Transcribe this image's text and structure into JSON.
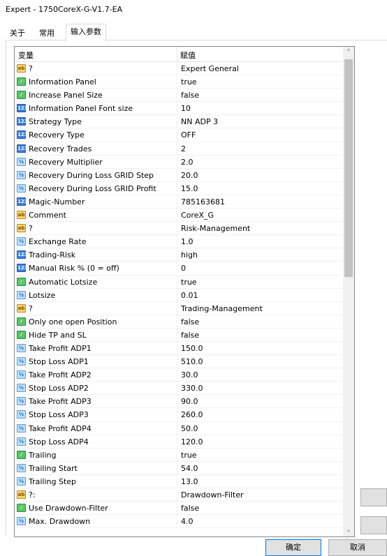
{
  "window": {
    "title": "Expert - 1750CoreX-G-V1.7-EA"
  },
  "tabs": [
    {
      "label": "关于"
    },
    {
      "label": "常用"
    },
    {
      "label": "输入参数"
    }
  ],
  "grid": {
    "col_variable": "变量",
    "col_value": "赋值",
    "rows": [
      {
        "icon": "ab",
        "name": "?",
        "value": "Expert General"
      },
      {
        "icon": "bool",
        "name": "Information Panel",
        "value": "true"
      },
      {
        "icon": "bool",
        "name": "Increase Panel Size",
        "value": "false"
      },
      {
        "icon": "int",
        "name": "Information Panel Font size",
        "value": "10"
      },
      {
        "icon": "int",
        "name": "Strategy Type",
        "value": "NN ADP 3"
      },
      {
        "icon": "int",
        "name": "Recovery Type",
        "value": "OFF"
      },
      {
        "icon": "int",
        "name": "Recovery Trades",
        "value": "2"
      },
      {
        "icon": "dbl",
        "name": "Recovery Multiplier",
        "value": "2.0"
      },
      {
        "icon": "dbl",
        "name": "Recovery During Loss GRID Step",
        "value": "20.0"
      },
      {
        "icon": "dbl",
        "name": "Recovery During Loss GRID Profit",
        "value": "15.0"
      },
      {
        "icon": "int",
        "name": "Magic-Number",
        "value": "785163681"
      },
      {
        "icon": "ab",
        "name": "Comment",
        "value": "CoreX_G"
      },
      {
        "icon": "ab",
        "name": "?",
        "value": "Risk-Management"
      },
      {
        "icon": "dbl",
        "name": "Exchange Rate",
        "value": "1.0"
      },
      {
        "icon": "int",
        "name": "Trading-Risk",
        "value": "high"
      },
      {
        "icon": "int",
        "name": "Manual Risk % (0 = off)",
        "value": "0"
      },
      {
        "icon": "bool",
        "name": "Automatic Lotsize",
        "value": "true"
      },
      {
        "icon": "dbl",
        "name": "Lotsize",
        "value": "0.01"
      },
      {
        "icon": "ab",
        "name": "?",
        "value": "Trading-Management"
      },
      {
        "icon": "bool",
        "name": "Only one open Position",
        "value": "false"
      },
      {
        "icon": "bool",
        "name": "Hide TP and SL",
        "value": "false"
      },
      {
        "icon": "dbl",
        "name": "Take Profit ADP1",
        "value": "150.0"
      },
      {
        "icon": "dbl",
        "name": "Stop Loss ADP1",
        "value": "510.0"
      },
      {
        "icon": "dbl",
        "name": "Take Profit ADP2",
        "value": "30.0"
      },
      {
        "icon": "dbl",
        "name": "Stop Loss ADP2",
        "value": "330.0"
      },
      {
        "icon": "dbl",
        "name": "Take Profit ADP3",
        "value": "90.0"
      },
      {
        "icon": "dbl",
        "name": "Stop Loss ADP3",
        "value": "260.0"
      },
      {
        "icon": "dbl",
        "name": "Take Profit ADP4",
        "value": "50.0"
      },
      {
        "icon": "dbl",
        "name": "Stop Loss ADP4",
        "value": "120.0"
      },
      {
        "icon": "bool",
        "name": "Trailing",
        "value": "true"
      },
      {
        "icon": "dbl",
        "name": "Trailing Start",
        "value": "54.0"
      },
      {
        "icon": "dbl",
        "name": "Trailing Step",
        "value": "13.0"
      },
      {
        "icon": "ab",
        "name": "?:",
        "value": "Drawdown-Filter"
      },
      {
        "icon": "bool",
        "name": "Use Drawdown-Filter",
        "value": "false"
      },
      {
        "icon": "dbl",
        "name": "Max. Drawdown",
        "value": "4.0"
      }
    ]
  },
  "icons": {
    "ab": {
      "glyph": "ab",
      "name": "string-type-icon"
    },
    "bool": {
      "glyph": "⁄",
      "name": "bool-type-icon"
    },
    "int": {
      "glyph": "123",
      "name": "integer-type-icon"
    },
    "dbl": {
      "glyph": "½",
      "name": "double-type-icon"
    }
  },
  "buttons": {
    "ok": "确定",
    "cancel": "取消"
  },
  "scroll": {
    "up_glyph": "⌃",
    "down_glyph": "⌄"
  }
}
